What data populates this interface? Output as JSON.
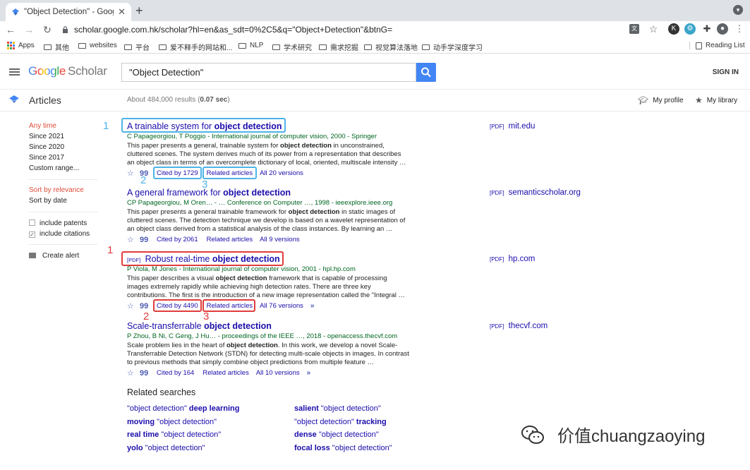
{
  "browser": {
    "tab_title": "\"Object Detection\" - Google Sc",
    "url": "scholar.google.com.hk/scholar?hl=en&as_sdt=0%2C5&q=\"Object+Detection\"&btnG=",
    "reading_list": "Reading List",
    "bookmarks": [
      "Apps",
      "其他",
      "websites",
      "平台",
      "爱不释手的网站和...",
      "NLP",
      "学术研究",
      "需求挖掘",
      "视觉算法落地",
      "动手学深度学习"
    ]
  },
  "header": {
    "logo_google": "Google",
    "logo_scholar": "Scholar",
    "search_value": "\"Object Detection\"",
    "sign_in": "SIGN IN"
  },
  "articles_bar": {
    "label": "Articles",
    "results_prefix": "About 484,000 results (",
    "results_time": "0.07 sec",
    "results_suffix": ")",
    "my_profile": "My profile",
    "my_library": "My library"
  },
  "sidebar": {
    "time_filters": [
      "Any time",
      "Since 2021",
      "Since 2020",
      "Since 2017",
      "Custom range..."
    ],
    "sort_options": [
      "Sort by relevance",
      "Sort by date"
    ],
    "include_patents": "include patents",
    "include_citations": "include citations",
    "create_alert": "Create alert"
  },
  "results": [
    {
      "title_pre": "A trainable system for ",
      "title_bold": "object detection",
      "pdf": false,
      "authors": "C Papageorgiou, T Poggio - International journal of computer vision, 2000 - Springer",
      "snippet_html": "This paper presents a general, trainable system for <b>object detection</b> in unconstrained, cluttered scenes. The system derives much of its power from a representation that describes an object class in terms of an overcomplete dictionary of local, oriented, multiscale intensity …",
      "cited_by": "Cited by 1729",
      "related": "Related articles",
      "versions": "All 20 versions",
      "side_tag": "[PDF]",
      "side_domain": "mit.edu"
    },
    {
      "title_pre": "A general framework for ",
      "title_bold": "object detection",
      "pdf": false,
      "authors": "CP Papageorgiou, M Oren… - … Conference on Computer …, 1998 - ieeexplore.ieee.org",
      "snippet_html": "This paper presents a general trainable framework for <b>object detection</b> in static images of cluttered scenes. The detection technique we develop is based on a wavelet representation of an object class derived from a statistical analysis of the class instances. By learning an …",
      "cited_by": "Cited by 2061",
      "related": "Related articles",
      "versions": "All 9 versions",
      "side_tag": "[PDF]",
      "side_domain": "semanticscholar.org"
    },
    {
      "title_pre": "Robust real-time ",
      "title_bold": "object detection",
      "pdf": true,
      "authors": "P Viola, M Jones - International journal of computer vision, 2001 - hpl.hp.com",
      "snippet_html": "This paper describes a visual <b>object detection</b> framework that is capable of processing images extremely rapidly while achieving high detection rates. There are three key contributions. The first is the introduction of a new image representation called the \"Integral …",
      "cited_by": "Cited by 4490",
      "related": "Related articles",
      "versions": "All 76 versions",
      "side_tag": "[PDF]",
      "side_domain": "hp.com"
    },
    {
      "title_pre": "Scale-transferrable ",
      "title_bold": "object detection",
      "pdf": false,
      "authors": "P Zhou, B Ni, C Geng, J Hu… - proceedings of the IEEE …, 2018 - openaccess.thecvf.com",
      "snippet_html": "Scale problem lies in the heart of <b>object detection</b>. In this work, we develop a novel Scale-Transferrable Detection Network (STDN) for detecting multi-scale objects in images. In contrast to previous methods that simply combine object predictions from multiple feature …",
      "cited_by": "Cited by 164",
      "related": "Related articles",
      "versions": "All 10 versions",
      "side_tag": "[PDF]",
      "side_domain": "thecvf.com"
    }
  ],
  "pdf_label": "[PDF]",
  "annotations": {
    "blue_numbers": [
      "1",
      "2",
      "3"
    ],
    "red_numbers": [
      "1",
      "2",
      "3"
    ],
    "blue_color": "#4db3e8",
    "red_color": "#e03c3c"
  },
  "related_searches": {
    "heading": "Related searches",
    "items": [
      {
        "pre": "\"object detection\" ",
        "bold": "deep learning",
        "bold_first": false
      },
      {
        "pre": "\"object detection\"",
        "bold": "salient ",
        "bold_first": true
      },
      {
        "pre": "\"object detection\"",
        "bold": "moving ",
        "bold_first": true
      },
      {
        "pre": "\"object detection\" ",
        "bold": "tracking",
        "bold_first": false
      },
      {
        "pre": "\"object detection\"",
        "bold": "real time ",
        "bold_first": true
      },
      {
        "pre": "\"object detection\"",
        "bold": "dense ",
        "bold_first": true
      },
      {
        "pre": "\"object detection\"",
        "bold": "yolo ",
        "bold_first": true
      },
      {
        "pre": "\"object detection\"",
        "bold": "focal loss ",
        "bold_first": true
      }
    ]
  },
  "watermark": "价值chuangzaoying"
}
